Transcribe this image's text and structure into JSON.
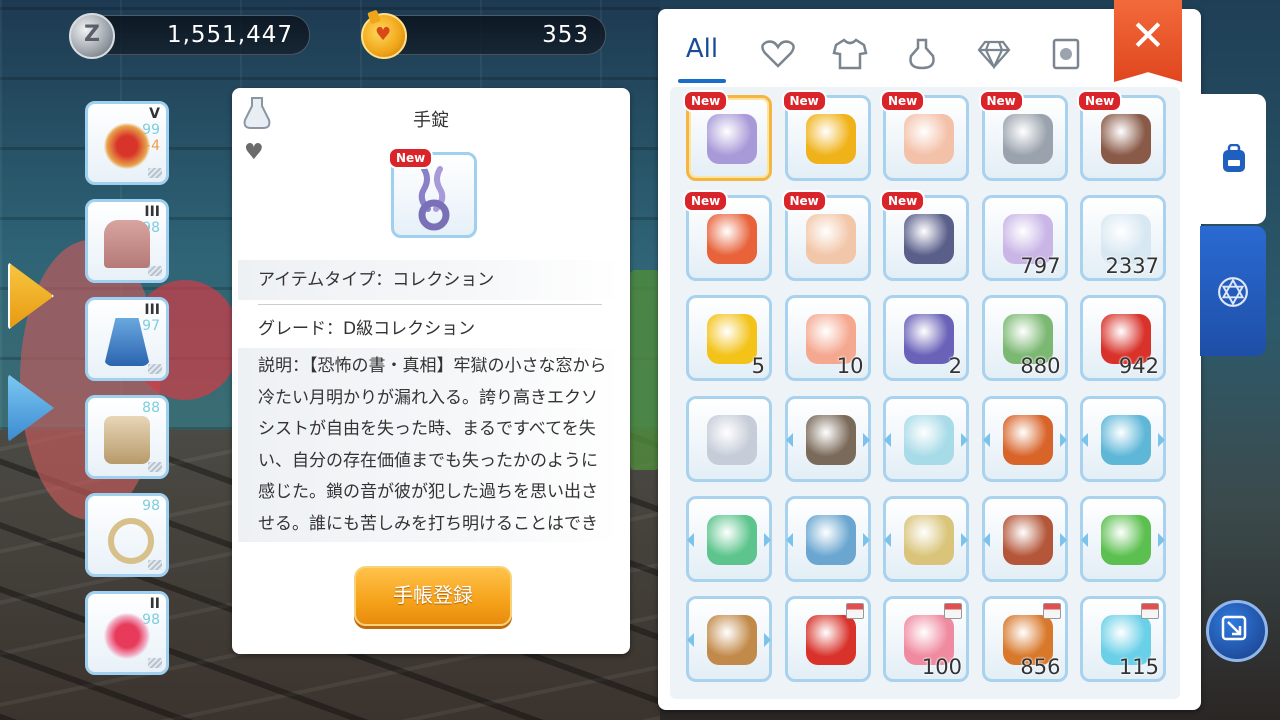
{
  "currency": {
    "zeny": {
      "icon": "zeny-coin-icon",
      "value": "1,551,447"
    },
    "cat_coin": {
      "icon": "cat-coin-icon",
      "value": "353"
    }
  },
  "equipment": [
    {
      "name": "accessory-slot",
      "tier": "V",
      "level": "99",
      "refine": "+4"
    },
    {
      "name": "armor-slot",
      "tier": "III",
      "level": "98"
    },
    {
      "name": "garment-slot",
      "tier": "III",
      "level": "97"
    },
    {
      "name": "shoes-slot",
      "level": "88"
    },
    {
      "name": "ring-slot",
      "level": "98"
    },
    {
      "name": "heart-accessory-slot",
      "tier": "II",
      "level": "98"
    }
  ],
  "detail": {
    "title": "手錠",
    "new_badge": "New",
    "item_type": "アイテムタイプ：コレクション",
    "grade": "グレード：D級コレクション",
    "description": "説明：【恐怖の書・真相】牢獄の小さな窓から冷たい月明かりが漏れ入る。誇り高きエクソシストが自由を失った時、まるですべてを失い、自分の存在価値までも失ったかのように感じた。鎖の音が彼が犯した過ちを思い出させる。誰にも苦しみを打ち明けることはできない。彼を孤",
    "register_button": "手帳登録"
  },
  "inventory": {
    "tabs": [
      {
        "id": "all",
        "label": "All"
      },
      {
        "id": "favorite",
        "icon": "heart-outline-icon"
      },
      {
        "id": "equipment",
        "icon": "shirt-icon"
      },
      {
        "id": "consumable",
        "icon": "potion-icon"
      },
      {
        "id": "cards",
        "icon": "gem-icon"
      },
      {
        "id": "collection",
        "icon": "card-face-icon"
      }
    ],
    "close_label": "✕",
    "new_label": "New",
    "items": [
      {
        "name": "handcuffs",
        "new": true,
        "selected": true,
        "color": "#a89ad8"
      },
      {
        "name": "gold-g-coin",
        "new": true,
        "color": "#f0b219"
      },
      {
        "name": "poring-scroll",
        "new": true,
        "color": "#f3c0a8"
      },
      {
        "name": "silver-key",
        "new": true,
        "color": "#9aa3ad"
      },
      {
        "name": "meat",
        "new": true,
        "color": "#8a5a48"
      },
      {
        "name": "fire-eye",
        "new": true,
        "color": "#e8623a"
      },
      {
        "name": "crown",
        "new": true,
        "color": "#f2c6a8"
      },
      {
        "name": "dark-book",
        "new": true,
        "color": "#5a5f8a"
      },
      {
        "name": "fairy-wing",
        "count": "797",
        "color": "#c9b5e6"
      },
      {
        "name": "feather",
        "count": "2337",
        "color": "#d8e8f2"
      },
      {
        "name": "star-card",
        "count": "5",
        "color": "#f3c31a"
      },
      {
        "name": "pink-goblet",
        "count": "10",
        "color": "#f5a890"
      },
      {
        "name": "purple-tome",
        "count": "2",
        "color": "#6a62b8"
      },
      {
        "name": "green-herb",
        "count": "880",
        "color": "#7bb872"
      },
      {
        "name": "red-envelope",
        "count": "942",
        "color": "#d8322a"
      },
      {
        "name": "sword-medal",
        "color": "#c6ccd8"
      },
      {
        "name": "bread-book",
        "arrows": true,
        "color": "#7a6a5a"
      },
      {
        "name": "pink-cube",
        "arrows": true,
        "color": "#a8dbe8"
      },
      {
        "name": "red-album",
        "arrows": true,
        "color": "#d8642a"
      },
      {
        "name": "crystal-amulet",
        "arrows": true,
        "color": "#5fb7d8"
      },
      {
        "name": "cat-ticket",
        "arrows": true,
        "color": "#5cc48c"
      },
      {
        "name": "open-book",
        "arrows": true,
        "color": "#6aa6d0"
      },
      {
        "name": "golden-statue",
        "arrows": true,
        "color": "#d9c47a"
      },
      {
        "name": "leather-diary",
        "arrows": true,
        "color": "#b4563a"
      },
      {
        "name": "mystery-box",
        "arrows": true,
        "color": "#5cc050"
      },
      {
        "name": "backpack",
        "arrows": true,
        "color": "#c28a4a"
      },
      {
        "name": "red-folder",
        "shop": true,
        "color": "#d8322a"
      },
      {
        "name": "pink-flower-frame",
        "shop": true,
        "count": "100",
        "color": "#f08aa0"
      },
      {
        "name": "bronze-coin",
        "shop": true,
        "count": "856",
        "color": "#d8782a"
      },
      {
        "name": "snowflake",
        "shop": true,
        "count": "115",
        "color": "#6ad0e8"
      }
    ]
  },
  "side_tabs": [
    {
      "name": "bag-tab",
      "icon": "backpack-icon"
    },
    {
      "name": "magic-tab",
      "icon": "hexagram-icon"
    }
  ]
}
